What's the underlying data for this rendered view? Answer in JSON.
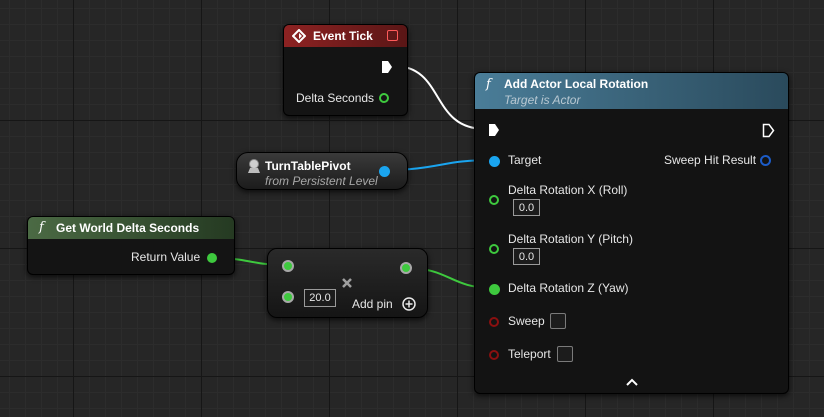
{
  "event_tick": {
    "title": "Event Tick",
    "delta_seconds": "Delta Seconds"
  },
  "turntable": {
    "title": "TurnTablePivot",
    "subtitle": "from Persistent Level"
  },
  "world_delta": {
    "title": "Get World Delta Seconds",
    "return_value": "Return Value"
  },
  "multiply": {
    "value": "20.0",
    "add_pin": "Add pin"
  },
  "add_rotation": {
    "title": "Add Actor Local Rotation",
    "subtitle": "Target is Actor",
    "target": "Target",
    "sweep_hit_result": "Sweep Hit Result",
    "roll_label": "Delta Rotation X (Roll)",
    "roll_value": "0.0",
    "pitch_label": "Delta Rotation Y (Pitch)",
    "pitch_value": "0.0",
    "yaw_label": "Delta Rotation Z (Yaw)",
    "sweep": "Sweep",
    "teleport": "Teleport"
  },
  "colors": {
    "event_header": "#7a1d1d",
    "function_header": "#3f6275",
    "pure_header": "#3f5a38",
    "object_pin": "#1aa5f0",
    "float_pin": "#3ec93e",
    "bool_pin": "#8a1010",
    "struct_pin": "#1c5cc8"
  }
}
